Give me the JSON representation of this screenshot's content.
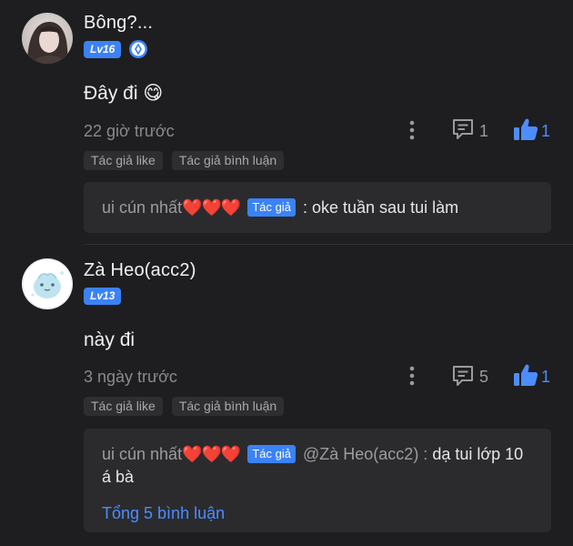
{
  "comments": [
    {
      "username": "Bông?...",
      "level": "Lv16",
      "content": "Đây đi 😋",
      "time": "22 giờ trước",
      "reply_count": "1",
      "like_count": "1",
      "tags": [
        "Tác giả like",
        "Tác giả bình luận"
      ],
      "reply": {
        "author": "ui cún nhất",
        "hearts": "❤️❤️❤️",
        "author_tag": "Tác giả",
        "mention": "",
        "text": ": oke tuần sau tui làm"
      }
    },
    {
      "username": "Zà Heo(acc2)",
      "level": "Lv13",
      "content": "này đi",
      "time": "3 ngày trước",
      "reply_count": "5",
      "like_count": "1",
      "tags": [
        "Tác giả like",
        "Tác giả bình luận"
      ],
      "reply": {
        "author": "ui cún nhất",
        "hearts": "❤️❤️❤️",
        "author_tag": "Tác giả",
        "mention": "@Zà Heo(acc2) :",
        "text": " dạ tui lớp 10 á bà"
      },
      "total_replies_link": "Tổng 5 bình luận"
    }
  ],
  "colors": {
    "background": "#1e1e20",
    "accent": "#4c8dff",
    "badge": "#3b82f6",
    "heart": "#e53935"
  },
  "icons": [
    "avatar-photo",
    "vip-diamond-icon",
    "more-vertical-icon",
    "reply-icon",
    "thumbs-up-icon"
  ]
}
